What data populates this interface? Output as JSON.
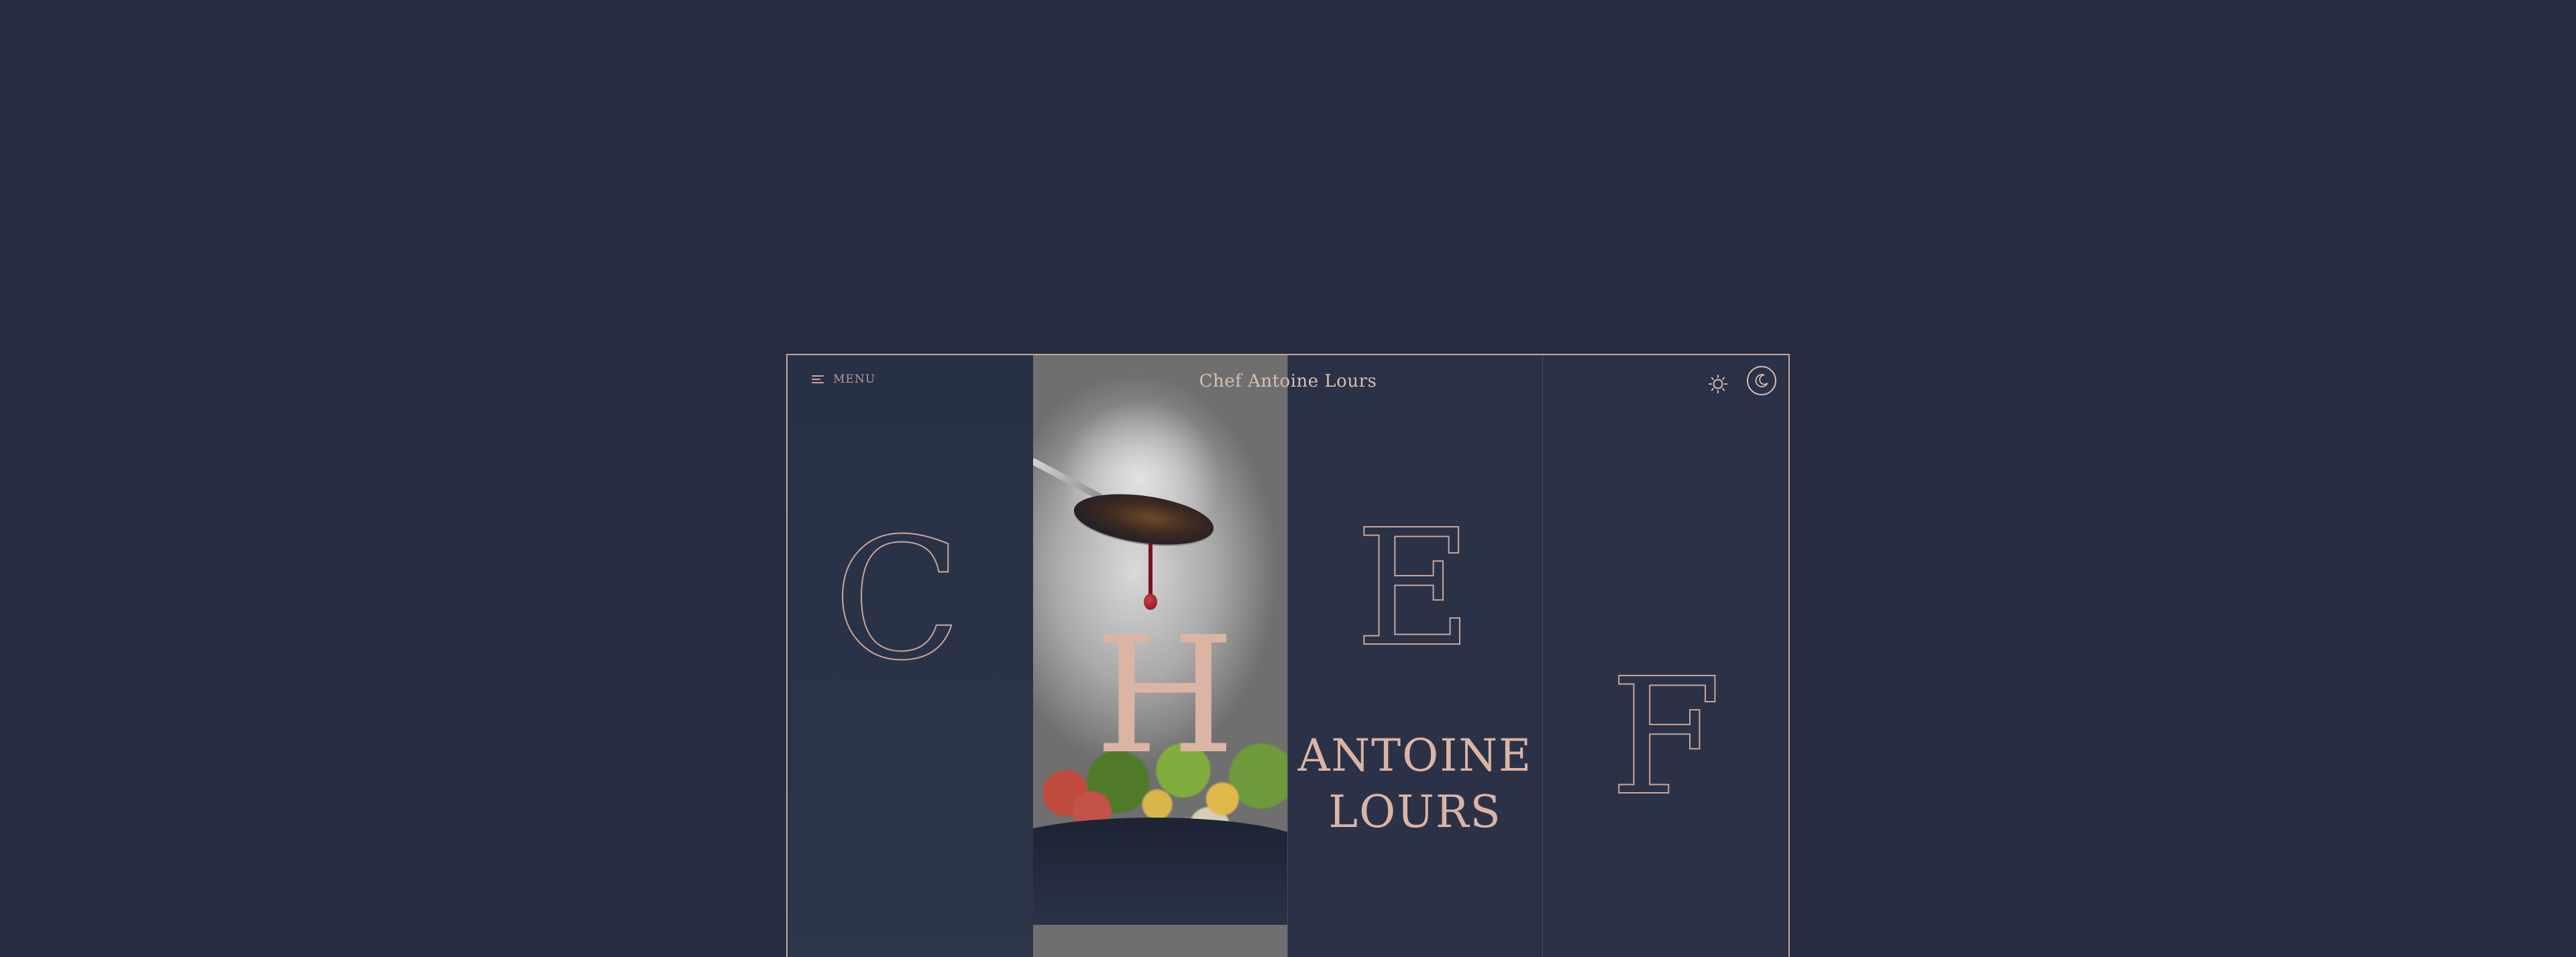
{
  "header": {
    "menu_label": "MENU",
    "site_title": "Chef Antoine Lours",
    "light_mode_icon": "sun-icon",
    "dark_mode_icon": "moon-icon"
  },
  "hero": {
    "letters": [
      "C",
      "H",
      "E",
      "F"
    ],
    "name_line_1": "ANTOINE",
    "name_line_2": "LOURS",
    "photo_alt": "salad-with-sauce-drip"
  },
  "colors": {
    "background": "#262d41",
    "accent": "#dcb4a4",
    "outline": "#c9a79a"
  }
}
